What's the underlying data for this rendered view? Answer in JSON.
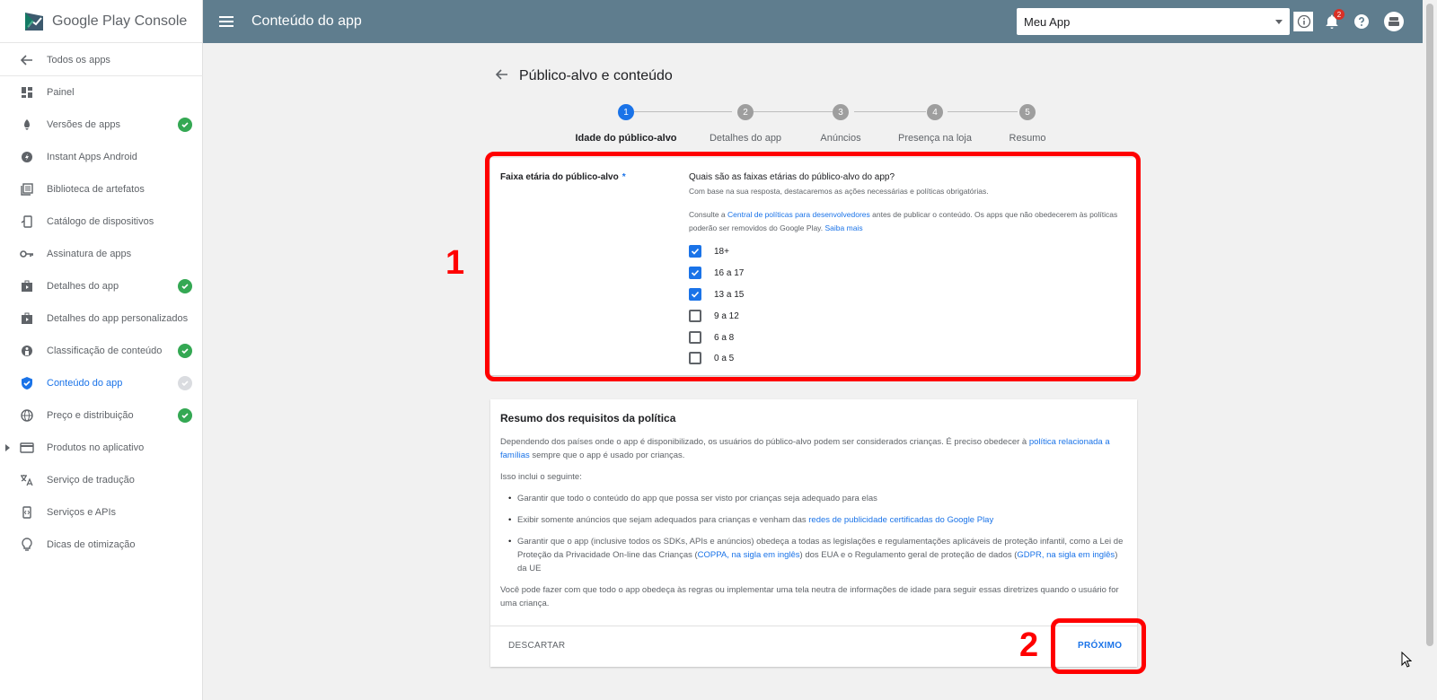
{
  "app": {
    "brand": "Google Play Console",
    "header_title": "Conteúdo do app",
    "selected_app": "Meu App",
    "notification_count": "2"
  },
  "sidebar": {
    "items": [
      {
        "label": "Todos os apps",
        "icon": "arrow-left-icon"
      },
      {
        "label": "Painel",
        "icon": "dashboard-icon"
      },
      {
        "label": "Versões de apps",
        "icon": "rocket-icon",
        "status": "complete"
      },
      {
        "label": "Instant Apps Android",
        "icon": "bolt-icon"
      },
      {
        "label": "Biblioteca de artefatos",
        "icon": "library-icon"
      },
      {
        "label": "Catálogo de dispositivos",
        "icon": "device-icon"
      },
      {
        "label": "Assinatura de apps",
        "icon": "key-icon"
      },
      {
        "label": "Detalhes do app",
        "icon": "store-icon",
        "status": "complete"
      },
      {
        "label": "Detalhes do app personalizados",
        "icon": "store-icon"
      },
      {
        "label": "Classificação de conteúdo",
        "icon": "rating-icon",
        "status": "complete"
      },
      {
        "label": "Conteúdo do app",
        "icon": "shield-icon",
        "status": "pending",
        "active": true
      },
      {
        "label": "Preço e distribuição",
        "icon": "globe-icon",
        "status": "complete"
      },
      {
        "label": "Produtos no aplicativo",
        "icon": "card-icon",
        "expandable": true
      },
      {
        "label": "Serviço de tradução",
        "icon": "translate-icon"
      },
      {
        "label": "Serviços e APIs",
        "icon": "api-icon"
      },
      {
        "label": "Dicas de otimização",
        "icon": "bulb-icon"
      }
    ]
  },
  "page": {
    "title": "Público-alvo e conteúdo",
    "steps": [
      {
        "num": "1",
        "label": "Idade do público-alvo",
        "active": true
      },
      {
        "num": "2",
        "label": "Detalhes do app"
      },
      {
        "num": "3",
        "label": "Anúncios"
      },
      {
        "num": "4",
        "label": "Presença na loja"
      },
      {
        "num": "5",
        "label": "Resumo"
      }
    ]
  },
  "age_card": {
    "field_label": "Faixa etária do público-alvo",
    "required_mark": "*",
    "question": "Quais são as faixas etárias do público-alvo do app?",
    "help": "Com base na sua resposta, destacaremos as ações necessárias e políticas obrigatórias.",
    "policy_pre": "Consulte a ",
    "policy_link": "Central de políticas para desenvolvedores",
    "policy_post": " antes de publicar o conteúdo. Os apps que não obedecerem às políticas poderão ser removidos do Google Play. ",
    "learn_more": "Saiba mais",
    "options": [
      {
        "label": "18+",
        "checked": true
      },
      {
        "label": "16 a 17",
        "checked": true
      },
      {
        "label": "13 a 15",
        "checked": true
      },
      {
        "label": "9 a 12",
        "checked": false
      },
      {
        "label": "6 a 8",
        "checked": false
      },
      {
        "label": "0 a 5",
        "checked": false
      }
    ]
  },
  "policy_card": {
    "title": "Resumo dos requisitos da política",
    "intro_pre": "Dependendo dos países onde o app é disponibilizado, os usuários do público-alvo podem ser considerados crianças. É preciso obedecer à ",
    "intro_link": "política relacionada a famílias",
    "intro_post": " sempre que o app é usado por crianças.",
    "includes": "Isso inclui o seguinte:",
    "bullet1": "Garantir que todo o conteúdo do app que possa ser visto por crianças seja adequado para elas",
    "bullet2_pre": "Exibir somente anúncios que sejam adequados para crianças e venham das ",
    "bullet2_link": "redes de publicidade certificadas do Google Play",
    "bullet3_pre": "Garantir que o app (inclusive todos os SDKs, APIs e anúncios) obedeça a todas as legislações e regulamentações aplicáveis de proteção infantil, como a Lei de Proteção da Privacidade On-line das Crianças (",
    "bullet3_link1": "COPPA, na sigla em inglês",
    "bullet3_mid": ") dos EUA e o Regulamento geral de proteção de dados (",
    "bullet3_link2": "GDPR, na sigla em inglês",
    "bullet3_post": ") da UE",
    "closing": "Você pode fazer com que todo o app obedeça às regras ou implementar uma tela neutra de informações de idade para seguir essas diretrizes quando o usuário for uma criança.",
    "discard_label": "DESCARTAR",
    "next_label": "PRÓXIMO"
  },
  "annotations": {
    "one": "1",
    "two": "2"
  },
  "colors": {
    "header": "#5f7d8e",
    "accent": "#1a73e8",
    "check": "#34a853",
    "annotation": "#ff0000"
  }
}
